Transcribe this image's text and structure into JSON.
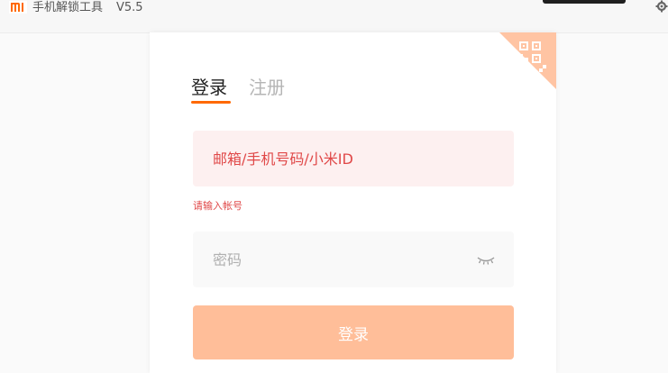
{
  "window": {
    "title": "手机解锁工具",
    "version": "V5.5",
    "logo_icon": "mi-logo-icon",
    "settings_icon": "gear-icon"
  },
  "login_form": {
    "tabs": [
      {
        "label": "登录",
        "active": true
      },
      {
        "label": "注册",
        "active": false
      }
    ],
    "account_placeholder": "邮箱/手机号码/小米ID",
    "account_value": "",
    "account_error": "请输入帐号",
    "password_placeholder": "密码",
    "password_value": "",
    "password_toggle_icon": "eye-closed-icon",
    "qr_icon": "qr-code-icon",
    "submit_label": "登录"
  },
  "colors": {
    "brand_orange": "#ff6900",
    "button_disabled": "#ffbe99",
    "qr_corner": "#ffc4a3",
    "error_red": "#e04848"
  }
}
